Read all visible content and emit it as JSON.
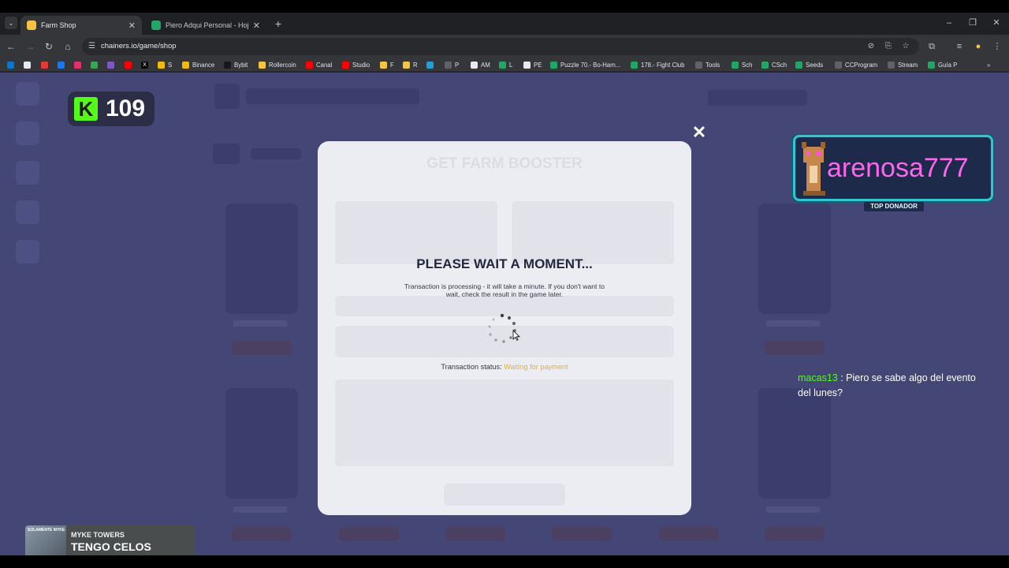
{
  "browser": {
    "tabs": [
      {
        "label": "Farm Shop",
        "active": true,
        "favicon_color": "#f5c542"
      },
      {
        "label": "Piero Adqui Personal - Hojas de",
        "active": false,
        "favicon_color": "#23a566"
      }
    ],
    "url": "chainers.io/game/shop"
  },
  "bookmarks": [
    {
      "label": "",
      "color": "#0078d4"
    },
    {
      "label": "",
      "color": "#e8eaed"
    },
    {
      "label": "",
      "color": "#e53935"
    },
    {
      "label": "",
      "color": "#1877f2"
    },
    {
      "label": "",
      "color": "#e1306c"
    },
    {
      "label": "",
      "color": "#34a853"
    },
    {
      "label": "",
      "color": "#7e57c2"
    },
    {
      "label": "",
      "color": "#ff0000"
    },
    {
      "label": "",
      "color": "#000000"
    },
    {
      "label": "S",
      "color": "#f0b90b"
    },
    {
      "label": "Binance",
      "color": "#f0b90b"
    },
    {
      "label": "Bybit",
      "color": "#17181e"
    },
    {
      "label": "Rollercoin",
      "color": "#f5c542"
    },
    {
      "label": "Canal",
      "color": "#ff0000"
    },
    {
      "label": "Studio",
      "color": "#ff0000"
    },
    {
      "label": "F",
      "color": "#f5c542"
    },
    {
      "label": "R",
      "color": "#f5c542"
    },
    {
      "label": "",
      "color": "#229ed9"
    },
    {
      "label": "P",
      "color": "#5f6368"
    },
    {
      "label": "AM",
      "color": "#e8eaed"
    },
    {
      "label": "L",
      "color": "#23a566"
    },
    {
      "label": "PE",
      "color": "#e8eaed"
    },
    {
      "label": "Puzzle 70.- Bo-Ham...",
      "color": "#23a566"
    },
    {
      "label": "178.- Fight Club",
      "color": "#23a566"
    },
    {
      "label": "Tools",
      "color": "#5f6368"
    },
    {
      "label": "Sch",
      "color": "#23a566"
    },
    {
      "label": "CSch",
      "color": "#23a566"
    },
    {
      "label": "Seeds",
      "color": "#23a566"
    },
    {
      "label": "CCProgram",
      "color": "#5f6368"
    },
    {
      "label": "Stream",
      "color": "#5f6368"
    },
    {
      "label": "Guía P",
      "color": "#23a566"
    }
  ],
  "overlay": {
    "kick_viewers": "109",
    "top_donor": {
      "name": "arenosa777",
      "tag": "TOP DONADOR"
    },
    "chat": {
      "user": "macas13",
      "message": "Piero se sabe algo del evento del lunes?"
    },
    "now_playing": {
      "artist": "MYKE TOWERS",
      "track": "TENGO CELOS",
      "cover_text": "SOLAMENTE MYKE"
    }
  },
  "modal": {
    "background_title": "GET FARM BOOSTER",
    "heading": "PLEASE WAIT A MOMENT...",
    "description": "Transaction is processing - it will take a minute. If you don't want to wait, check the result in the game later.",
    "status_label": "Transaction status:",
    "status_value": "Waiting for payment",
    "status_color": "#e0b245"
  },
  "colors": {
    "page_bg": "#444676",
    "accent_kick": "#53fc18",
    "donor_name": "#ff66ee",
    "donor_border": "#30c6d3"
  }
}
